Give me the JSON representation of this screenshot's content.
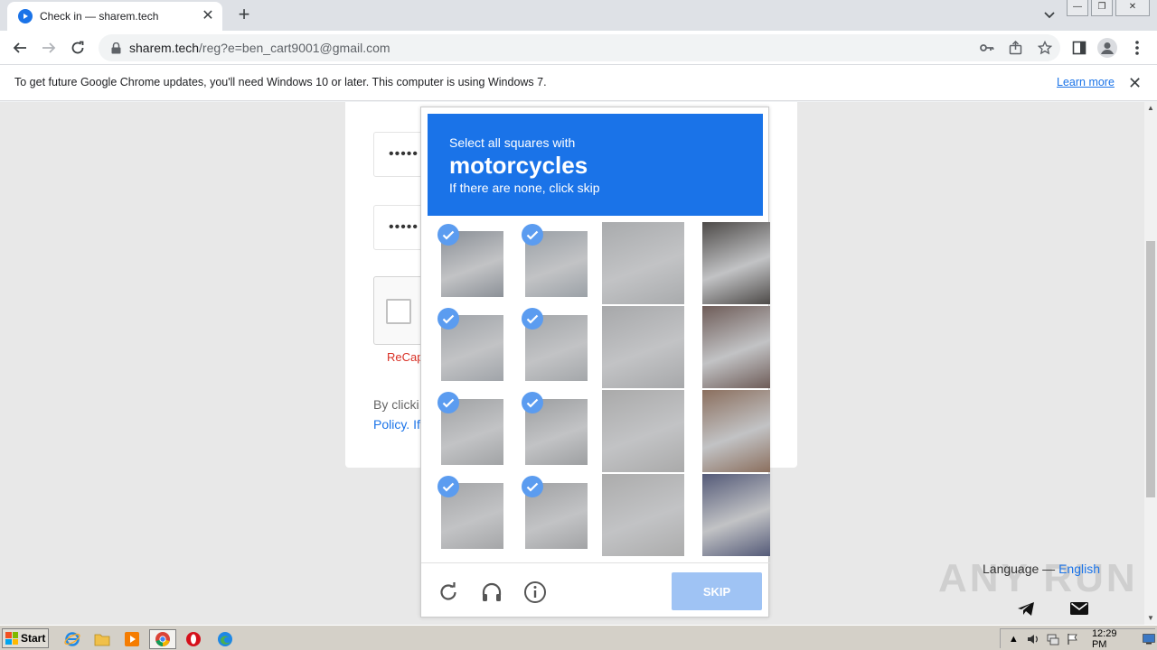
{
  "browser": {
    "tab_title": "Check in — sharem.tech",
    "url_host": "sharem.tech",
    "url_path": "/reg?e=ben_cart9001@gmail.com"
  },
  "infobar": {
    "message": "To get future Google Chrome updates, you'll need Windows 10 or later. This computer is using Windows 7.",
    "link": "Learn more"
  },
  "page": {
    "password_1": "•••••",
    "password_2": "•••••",
    "recaptcha_error": "ReCap",
    "legal_line1": "By clicki",
    "legal_line2": "Policy. If",
    "language_label": "Language —",
    "language_value": "English",
    "watermark": "ANY RUN"
  },
  "captcha": {
    "instruction": "Select all squares with",
    "target": "motorcycles",
    "hint": "If there are none, click skip",
    "skip_label": "SKIP",
    "tiles_selected": [
      true,
      true,
      false,
      false,
      true,
      true,
      false,
      false,
      true,
      true,
      false,
      false,
      true,
      true,
      false,
      false
    ],
    "header_color": "#1a73e8"
  },
  "taskbar": {
    "start_label": "Start",
    "clock": "12:29 PM"
  }
}
